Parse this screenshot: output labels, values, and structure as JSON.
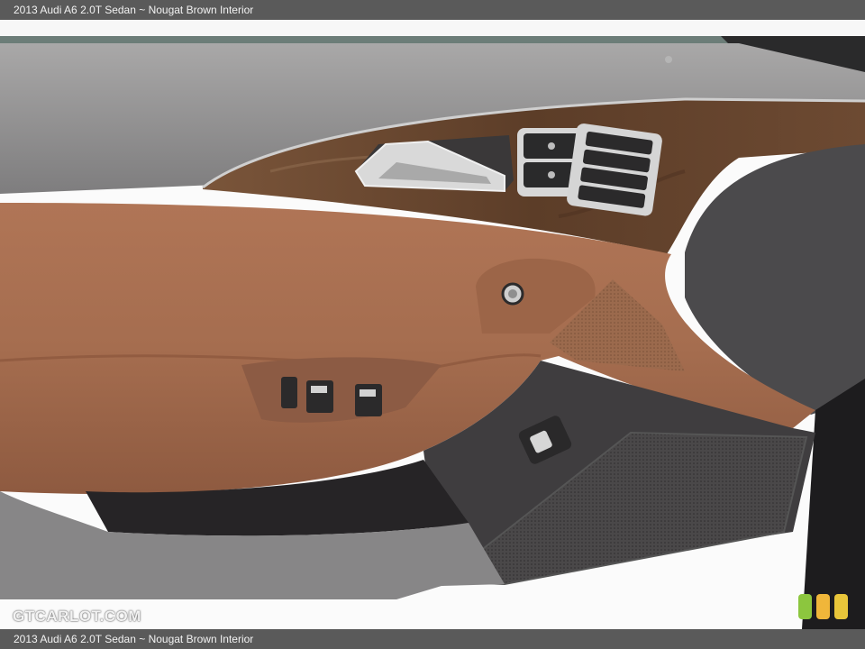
{
  "caption": {
    "top": "2013 Audi A6 2.0T Sedan ~ Nougat Brown Interior",
    "bottom": "2013 Audi A6 2.0T Sedan ~ Nougat Brown Interior"
  },
  "photo": {
    "subject": "door-panel-interior",
    "colors": {
      "leather": "#a66f4e",
      "wood_trim": "#6a4630",
      "panel_gray": "#8e8d8e",
      "dark_trim": "#3c3a3b"
    }
  },
  "watermark": {
    "text": "GTCARLOT.COM"
  },
  "badge": {
    "colors": [
      "#8cc63e",
      "#f0b63a",
      "#e8c53a"
    ]
  }
}
